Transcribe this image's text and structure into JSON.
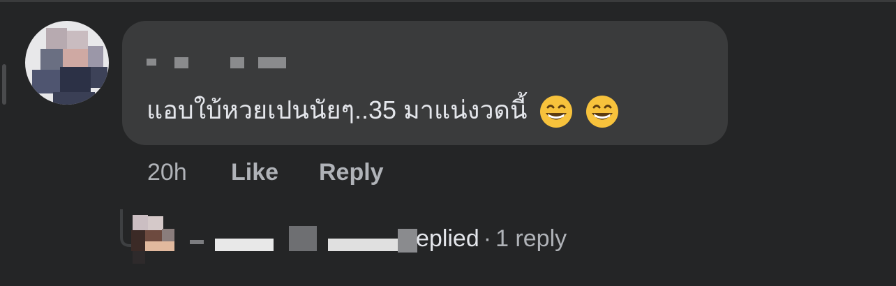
{
  "comment": {
    "text": "แอบใบ้หวยเปนนัยๆ..35 มาแน่งวดนี้",
    "emoji": [
      "grinning-face-with-smiling-eyes",
      "grinning-face-with-smiling-eyes"
    ],
    "timestamp": "20h",
    "like_label": "Like",
    "reply_label": "Reply"
  },
  "replies": {
    "replied_label": "eplied",
    "separator": "·",
    "count_label": "1 reply"
  },
  "colors": {
    "background": "#242526",
    "bubble": "#3a3b3c",
    "primary_text": "#e4e6eb",
    "secondary_text": "#b0b3b8"
  }
}
